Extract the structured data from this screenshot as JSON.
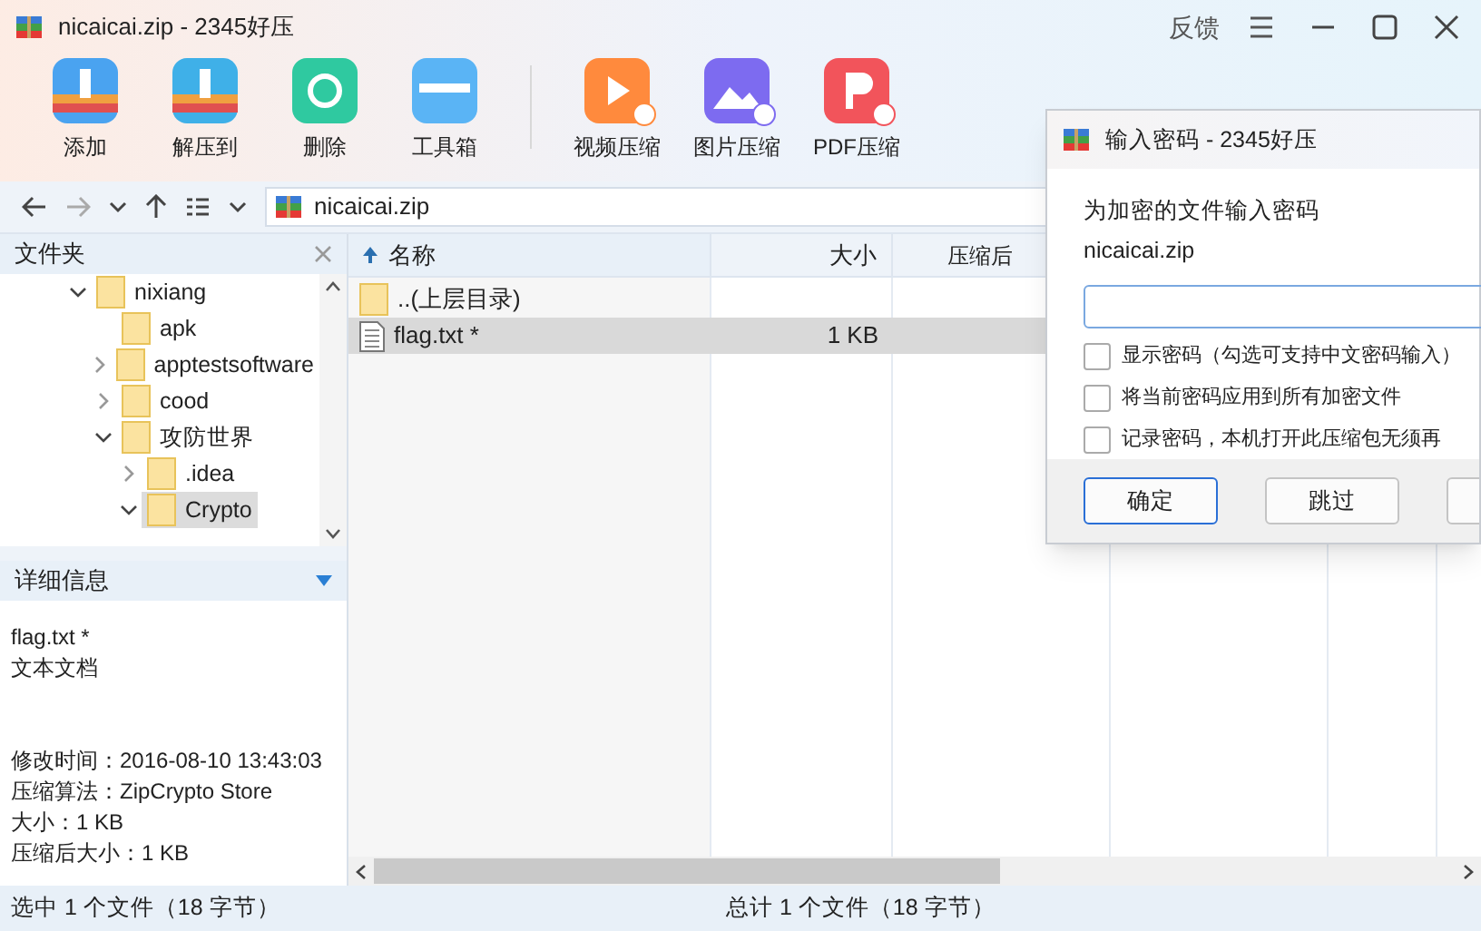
{
  "window": {
    "title": "nicaicai.zip - 2345好压",
    "feedback": "反馈"
  },
  "toolbar": [
    {
      "label": "添加",
      "kind": "add"
    },
    {
      "label": "解压到",
      "kind": "extract"
    },
    {
      "label": "删除",
      "kind": "delete"
    },
    {
      "label": "工具箱",
      "kind": "tools"
    },
    {
      "label": "视频压缩",
      "kind": "video"
    },
    {
      "label": "图片压缩",
      "kind": "image"
    },
    {
      "label": "PDF压缩",
      "kind": "pdf"
    }
  ],
  "address": {
    "path": "nicaicai.zip"
  },
  "folders": {
    "title": "文件夹",
    "tree": [
      {
        "label": "nixiang",
        "expanded": true,
        "selected": false,
        "children": [
          {
            "label": "apk",
            "selected": false
          },
          {
            "label": "apptestsoftware",
            "expanded": false,
            "selected": false
          },
          {
            "label": "cood",
            "expanded": false,
            "selected": false
          },
          {
            "label": "攻防世界",
            "expanded": true,
            "selected": false,
            "children": [
              {
                "label": ".idea",
                "expanded": false,
                "selected": false
              },
              {
                "label": "Crypto",
                "expanded": true,
                "selected": true
              }
            ]
          }
        ]
      }
    ]
  },
  "details": {
    "title": "详细信息",
    "name": "flag.txt *",
    "type": "文本文档",
    "lines": [
      "修改时间：2016-08-10 13:43:03",
      "压缩算法：ZipCrypto Store",
      "大小：1 KB",
      "压缩后大小：1 KB"
    ]
  },
  "table": {
    "columns": [
      "名称",
      "大小",
      "压缩后"
    ],
    "rows": [
      {
        "kind": "folder",
        "cells": [
          "..(上层目录)"
        ],
        "selected": false
      },
      {
        "kind": "file",
        "cells": [
          "flag.txt *",
          "1 KB"
        ],
        "selected": true
      }
    ]
  },
  "status_bar": {
    "left": "选中 1 个文件（18 字节）",
    "center": "总计 1 个文件（18 字节）"
  },
  "dialog": {
    "title": "输入密码 - 2345好压",
    "prompt": "为加密的文件输入密码",
    "file": "nicaicai.zip",
    "options": [
      {
        "label": "显示密码（勾选可支持中文密码输入）",
        "checked": false
      },
      {
        "label": "将当前密码应用到所有加密文件",
        "checked": false
      },
      {
        "label": "记录密码，本机打开此压缩包无须再",
        "checked": false
      }
    ],
    "buttons": [
      "确定",
      "跳过"
    ]
  }
}
